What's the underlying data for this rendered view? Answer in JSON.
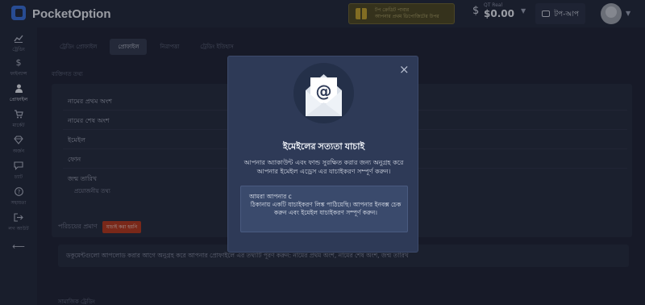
{
  "header": {
    "logo_text": "PocketOption",
    "promo_line1": "টপ ক্রেডিট পাবার",
    "promo_line2": "আপনার প্রথম ডিপোজিটের উপর",
    "balance_label": "QT Real",
    "balance_amount": "$0.00",
    "topup_label": "টপ-আপ"
  },
  "sidebar": {
    "items": [
      {
        "label": "ট্রেডিং",
        "icon": "chart-icon"
      },
      {
        "label": "ফাইন্যান্স",
        "icon": "dollar-icon"
      },
      {
        "label": "প্রোফাইল",
        "icon": "user-icon"
      },
      {
        "label": "মার্কেট",
        "icon": "cart-icon"
      },
      {
        "label": "অর্জন",
        "icon": "diamond-icon"
      },
      {
        "label": "চ্যাট",
        "icon": "chat-icon"
      },
      {
        "label": "সহায়তা",
        "icon": "help-icon"
      },
      {
        "label": "লগ আউট",
        "icon": "logout-icon"
      }
    ]
  },
  "tabs": [
    "ট্রেডিং প্রোফাইল",
    "প্রোফাইল",
    "নিরাপত্তা",
    "ট্রেডিং ইতিহাস"
  ],
  "form": {
    "section_title": "ব্যক্তিগত তথ্য",
    "first_name": "নামের প্রথম অংশ",
    "last_name": "নামের শেষ অংশ",
    "email": "ইমেইল",
    "phone": "ফোন",
    "dob": "জন্ম তারিখ",
    "dob_sub": "প্রয়োজনীয় তথ্য"
  },
  "verification": {
    "label": "পরিচয়ের প্রমাণ",
    "badge": "যাচাই করা হয়নি",
    "doc_text": "ডকুমেন্টগুলো আপলোড করার আগে অনুগ্রহ করে আপনার প্রোফাইলে এর তথ্যটি পূরণ করুন: নামের প্রথম অংশ, নামের শেষ অংশ, জন্ম তারিখ"
  },
  "bottom_section": "সামাজিক ট্রেডিং",
  "modal": {
    "title": "ইমেইলের সত্যতা যাচাই",
    "description": "আপনার অ্যাকাউন্ট এবং ফান্ড সুরক্ষিত করার জন্য অনুগ্রহ করে আপনার ইমেইল এড্রেস এর যাচাইকরণ সম্পূর্ণ করুন।",
    "notice_first": "আমরা আপনার c",
    "notice_rest": "ঠিকানায় একটি যাচাইকরণ লিঙ্ক পাঠিয়েছি। আপনার ইনবক্স চেক করুন এবং ইমেইল যাচাইকরণ সম্পূর্ণ করুন।",
    "close_glyph": "×"
  },
  "colors": {
    "background": "#1f2334",
    "modal": "#2e3a57",
    "badge": "#b5381d",
    "brand": "#3a6fd8"
  }
}
